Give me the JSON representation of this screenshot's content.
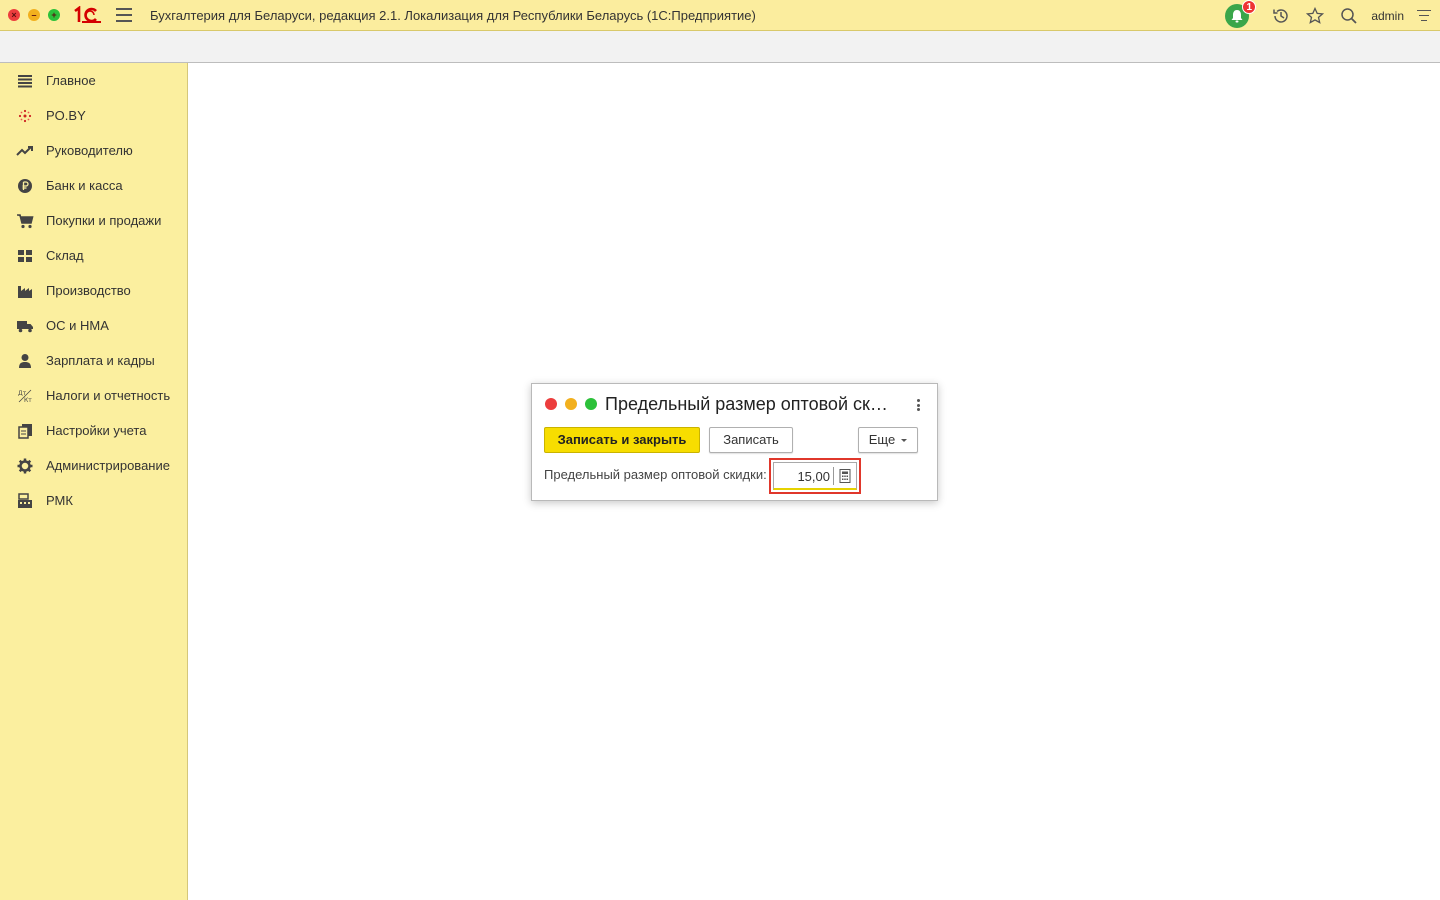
{
  "window": {
    "title": "Бухгалтерия для Беларуси, редакция 2.1. Локализация для Республики Беларусь   (1С:Предприятие)",
    "notifications_count": "1",
    "user": "admin"
  },
  "colors": {
    "accent_yellow": "#fbef9f",
    "primary_button": "#f7dd00",
    "highlight_red": "#e0372b"
  },
  "sidebar": {
    "items": [
      {
        "label": "Главное",
        "icon": "list-icon"
      },
      {
        "label": "PO.BY",
        "icon": "poby-icon"
      },
      {
        "label": "Руководителю",
        "icon": "trend-icon"
      },
      {
        "label": "Банк и касса",
        "icon": "ruble-coin-icon"
      },
      {
        "label": "Покупки и продажи",
        "icon": "cart-icon"
      },
      {
        "label": "Склад",
        "icon": "warehouse-grid-icon"
      },
      {
        "label": "Производство",
        "icon": "factory-icon"
      },
      {
        "label": "ОС и НМА",
        "icon": "truck-icon"
      },
      {
        "label": "Зарплата и кадры",
        "icon": "person-icon"
      },
      {
        "label": "Налоги и отчетность",
        "icon": "debit-credit-icon"
      },
      {
        "label": "Настройки учета",
        "icon": "documents-icon"
      },
      {
        "label": "Администрирование",
        "icon": "gear-icon"
      },
      {
        "label": "РМК",
        "icon": "cash-register-icon"
      }
    ]
  },
  "dialog": {
    "title": "Предельный размер оптовой скидки",
    "save_close_label": "Записать и закрыть",
    "save_label": "Записать",
    "more_label": "Еще",
    "field_label": "Предельный размер оптовой скидки:",
    "field_value": "15,00"
  }
}
